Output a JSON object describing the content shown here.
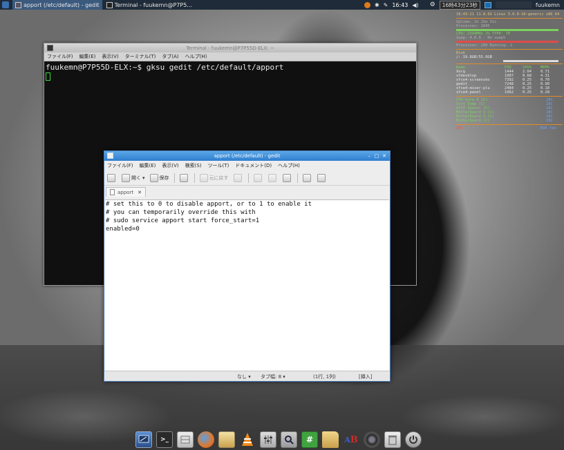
{
  "top_panel": {
    "tasks": [
      {
        "label": "apport (/etc/default) - gedit",
        "active": true
      },
      {
        "label": "Terminal - fuukemn@P7P5...",
        "active": false
      }
    ],
    "clock": "16:43",
    "date": "16時43分23秒",
    "user": "fuukemn"
  },
  "conky": {
    "header": "16:43:21 11.8.02 Linux 3.0.0-16-generic x86_64",
    "lines": [
      "Uptime: 1h 25m 31s",
      "Processes: 1845",
      "CPU: 2394MHz 1% TYPE: 78",
      "Swap: 4.0.0 - No swap%",
      "Processes: 200 Running: 2",
      "Disk",
      "/: 19.8GB/55.6GB"
    ],
    "proc_header": [
      "Name",
      "PID",
      "CPU%",
      "MEM%"
    ],
    "processes": [
      [
        "Xorg",
        "1444",
        "2.04",
        "0.71"
      ],
      [
        "xfdesktop",
        "1907",
        "0.68",
        "4.31"
      ],
      [
        "xfce4-screensho",
        "7392",
        "0.25",
        "0.70"
      ],
      [
        "gedit",
        "7248",
        "0.25",
        "0.90"
      ],
      [
        "xfce4-mixer-plu",
        "2484",
        "0.25",
        "0.18"
      ],
      [
        "xfce4-panel",
        "1962",
        "0.25",
        "0.28"
      ]
    ],
    "temps": [
      [
        "CPU Core 0 (C)",
        "28C"
      ],
      [
        "Core Temp (C)",
        "28C"
      ],
      [
        "ACPI Sensor (C)",
        "28C"
      ],
      [
        "Motherboard 1 (C)",
        "28C"
      ],
      [
        "Motherboard 2 (C)",
        "28C"
      ],
      [
        "Motherboard (C)",
        "28C"
      ]
    ],
    "gpu_label": "GPU",
    "gpu_value": "NVA fan"
  },
  "terminal": {
    "title": "Terminal - fuukemn@P7P55D-ELX: ~",
    "menu": [
      "ファイル(F)",
      "編集(E)",
      "表示(V)",
      "ターミナル(T)",
      "タブ(A)",
      "ヘルプ(H)"
    ],
    "command_line": "fuukemn@P7P55D-ELX:~$ gksu gedit /etc/default/apport"
  },
  "gedit": {
    "title": "apport (/etc/default) - gedit",
    "menu": [
      "ファイル(F)",
      "編集(E)",
      "表示(V)",
      "検索(S)",
      "ツール(T)",
      "ドキュメント(D)",
      "ヘルプ(H)"
    ],
    "toolbar": {
      "open_label": "開く",
      "save_label": "保存",
      "undo_label": "元に戻す"
    },
    "tab_label": "apport",
    "lines": [
      "# set this to 0 to disable apport, or to 1 to enable it",
      "# you can temporarily override this with",
      "# sudo service apport start force_start=1",
      "enabled=0"
    ],
    "status": {
      "language": "なし",
      "tab_width": "タブ幅: 8",
      "position": "(1行, 1列)",
      "mode": "[挿入]"
    }
  },
  "dock": {
    "icons": [
      "desktop-icon",
      "terminal-icon",
      "file-manager-icon",
      "firefox-icon",
      "image-viewer-icon",
      "vlc-icon",
      "mixer-icon",
      "search-icon",
      "hash-icon",
      "folder-icon",
      "text-icon",
      "camera-icon",
      "trash-icon",
      "logout-icon"
    ]
  },
  "colors": {
    "gedit_titlebar": "#2f7fd0",
    "panel_bg": "#1f2b38",
    "terminal_bg": "#101010",
    "cursor": "#3ddc3d"
  }
}
